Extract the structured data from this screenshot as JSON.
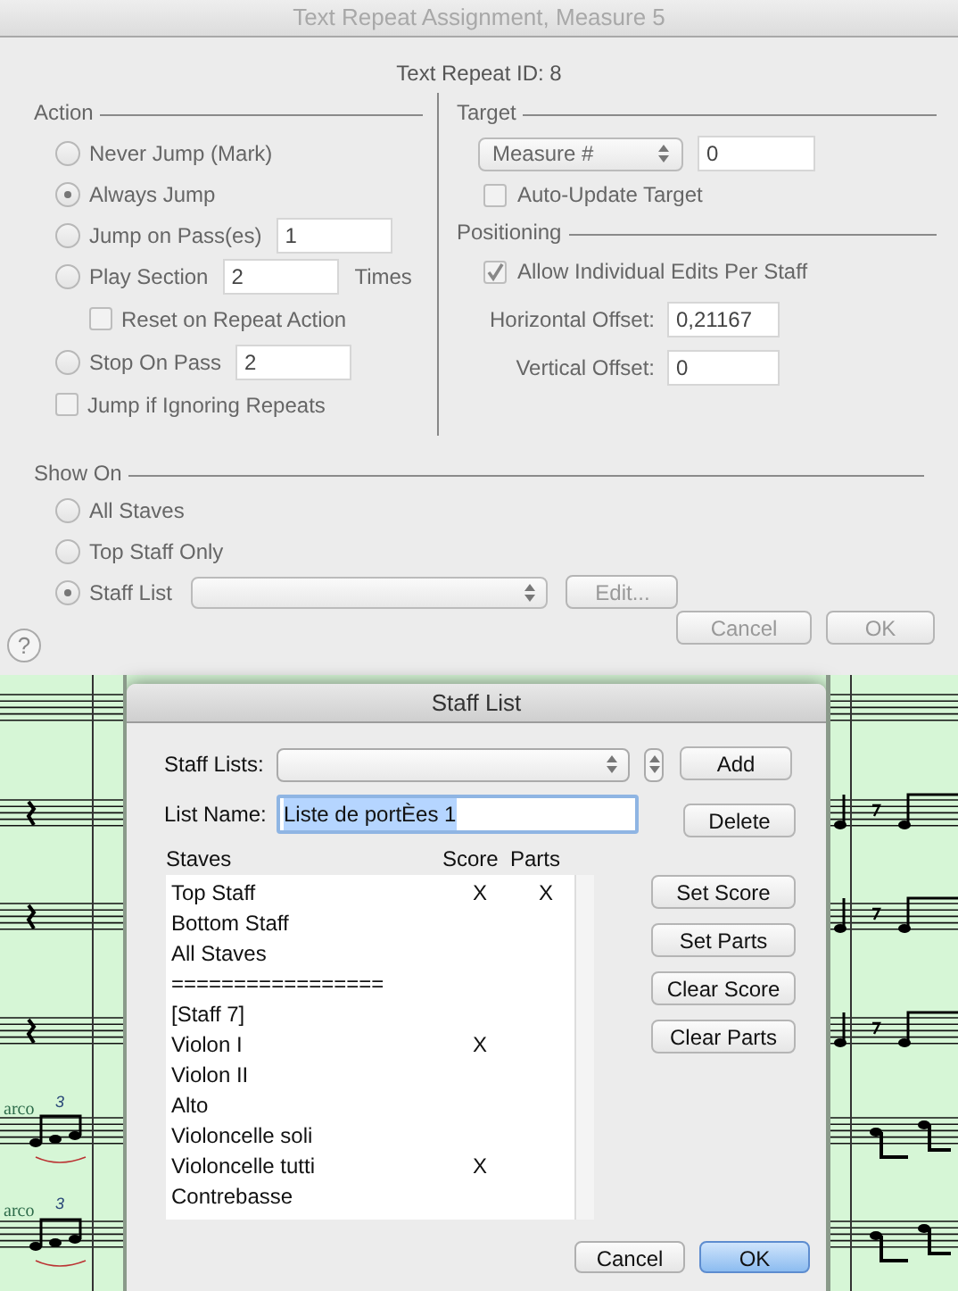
{
  "window": {
    "title": "Text Repeat Assignment, Measure 5"
  },
  "repeat_id": "Text Repeat ID: 8",
  "action": {
    "title": "Action",
    "items": [
      {
        "kind": "radio",
        "label": "Never Jump (Mark)",
        "selected": false
      },
      {
        "kind": "radio",
        "label": "Always Jump",
        "selected": true
      },
      {
        "kind": "radio",
        "label": "Jump on Pass(es)",
        "selected": false,
        "value": "1"
      },
      {
        "kind": "radio",
        "label": "Play Section",
        "selected": false,
        "value": "2",
        "suffix": "Times"
      },
      {
        "kind": "checkbox",
        "label": "Reset on Repeat Action",
        "checked": false,
        "indented": true
      },
      {
        "kind": "radio",
        "label": "Stop On Pass",
        "selected": false,
        "value": "2"
      },
      {
        "kind": "checkbox",
        "label": "Jump if Ignoring Repeats",
        "checked": false,
        "indented": false
      }
    ]
  },
  "target": {
    "title": "Target",
    "select": "Measure #",
    "value": "0",
    "auto_update": {
      "label": "Auto-Update Target",
      "checked": false
    }
  },
  "positioning": {
    "title": "Positioning",
    "allow_edits": {
      "label": "Allow Individual Edits Per Staff",
      "checked": true
    },
    "fields": [
      {
        "label": "Horizontal Offset:",
        "value": "0,21167"
      },
      {
        "label": "Vertical Offset:",
        "value": "0"
      }
    ]
  },
  "show_on": {
    "title": "Show On",
    "options": [
      {
        "label": "All Staves",
        "selected": false
      },
      {
        "label": "Top Staff Only",
        "selected": false
      },
      {
        "label": "Staff List",
        "selected": true,
        "button": "Edit..."
      }
    ]
  },
  "buttons": [
    "Cancel",
    "OK"
  ],
  "help": "?",
  "score_marks": [
    {
      "text": "arco",
      "tuplet": "3"
    },
    {
      "text": "arco",
      "tuplet": "3"
    }
  ],
  "staff_list_dialog": {
    "title": "Staff List",
    "staff_lists_label": "Staff Lists:",
    "add": "Add",
    "list_name_label": "List Name:",
    "list_name": "Liste de portÈes 1",
    "list_name_selected": true,
    "delete": "Delete",
    "columns": [
      "Staves",
      "Score",
      "Parts"
    ],
    "rows": [
      {
        "staff": "Top Staff",
        "score": "X",
        "parts": "X"
      },
      {
        "staff": "Bottom Staff"
      },
      {
        "staff": "All Staves"
      },
      {
        "staff": "================="
      },
      {
        "staff": "[Staff 7]"
      },
      {
        "staff": "Violon I",
        "score": "X"
      },
      {
        "staff": "Violon II"
      },
      {
        "staff": "Alto"
      },
      {
        "staff": "Violoncelle soli"
      },
      {
        "staff": "Violoncelle tutti",
        "score": "X"
      },
      {
        "staff": "Contrebasse"
      }
    ],
    "side_buttons": [
      "Set Score",
      "Set Parts",
      "Clear Score",
      "Clear Parts"
    ],
    "buttons": [
      {
        "label": "Cancel",
        "default": false
      },
      {
        "label": "OK",
        "default": true
      }
    ]
  }
}
